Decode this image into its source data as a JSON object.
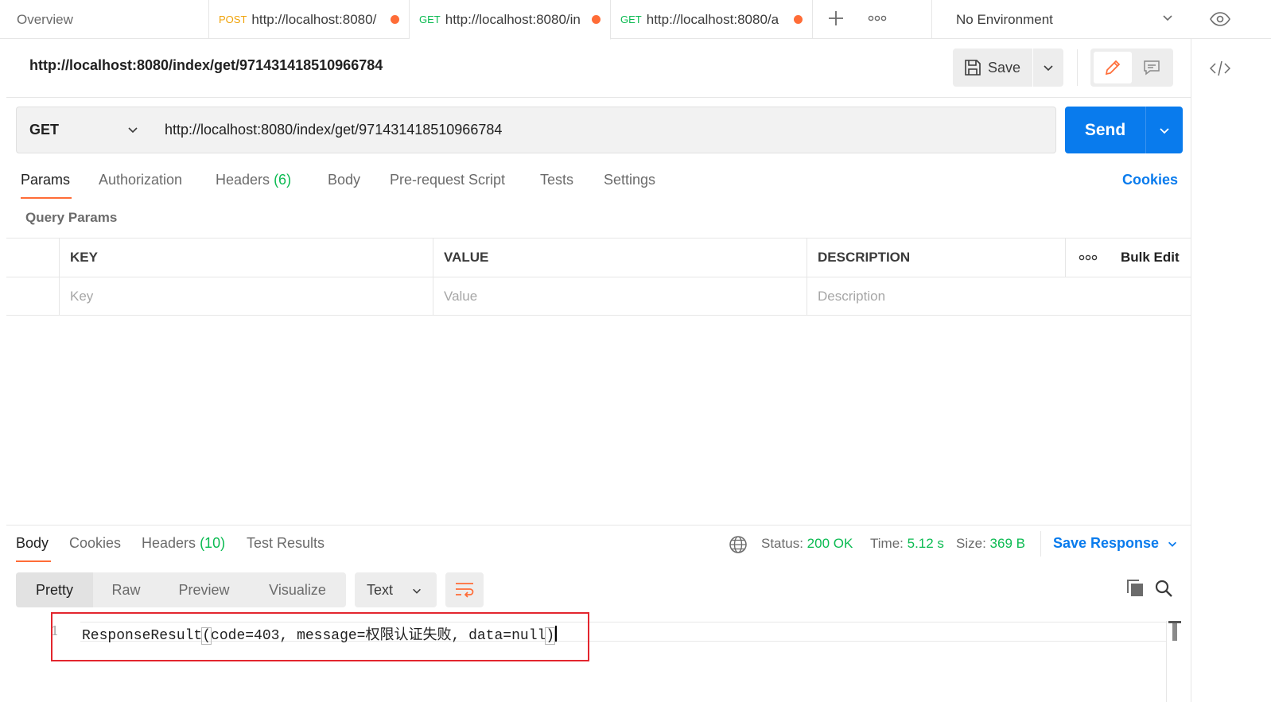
{
  "tabs": {
    "overview": "Overview",
    "items": [
      {
        "method": "POST",
        "url": "http://localhost:8080/"
      },
      {
        "method": "GET",
        "url": "http://localhost:8080/in"
      },
      {
        "method": "GET",
        "url": "http://localhost:8080/a"
      }
    ]
  },
  "environment": "No Environment",
  "request": {
    "title": "http://localhost:8080/index/get/971431418510966784",
    "save_label": "Save",
    "method": "GET",
    "url": "http://localhost:8080/index/get/971431418510966784",
    "send_label": "Send"
  },
  "request_tabs": {
    "params": "Params",
    "authorization": "Authorization",
    "headers": "Headers",
    "headers_count": "(6)",
    "body": "Body",
    "prerequest": "Pre-request Script",
    "tests": "Tests",
    "settings": "Settings",
    "cookies": "Cookies"
  },
  "query_params": {
    "label": "Query Params",
    "columns": {
      "key": "KEY",
      "value": "VALUE",
      "description": "DESCRIPTION",
      "bulk_edit": "Bulk Edit"
    },
    "placeholders": {
      "key": "Key",
      "value": "Value",
      "description": "Description"
    }
  },
  "response": {
    "tabs": {
      "body": "Body",
      "cookies": "Cookies",
      "headers": "Headers",
      "headers_count": "(10)",
      "test_results": "Test Results"
    },
    "status_label": "Status:",
    "status_value": "200 OK",
    "time_label": "Time:",
    "time_value": "5.12 s",
    "size_label": "Size:",
    "size_value": "369 B",
    "save_response": "Save Response",
    "formats": [
      "Pretty",
      "Raw",
      "Preview",
      "Visualize"
    ],
    "text_type": "Text",
    "line_number": "1",
    "code_prefix": "ResponseResult",
    "code_body": "code=403, message=权限认证失败, data=null"
  },
  "colors": {
    "accent": "#ff6c37",
    "primary": "#097bed",
    "success": "#0cbb52",
    "post": "#f0a30a",
    "highlight": "#e3262e"
  }
}
